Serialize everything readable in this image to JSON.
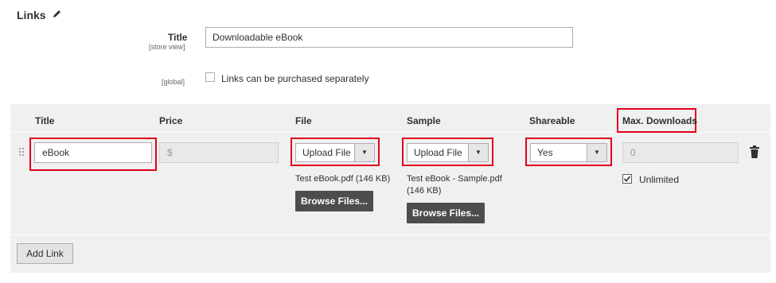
{
  "section": {
    "title": "Links"
  },
  "link_section": {
    "title_label": "Title",
    "title_scope": "[store view]",
    "title_value": "Downloadable eBook",
    "separately_scope": "[global]",
    "separately_label": "Links can be purchased separately",
    "separately_checked": false
  },
  "grid": {
    "columns": [
      "Title",
      "Price",
      "File",
      "Sample",
      "Shareable",
      "Max. Downloads"
    ],
    "row": {
      "title_value": "eBook",
      "price_placeholder": "$",
      "file_select": "Upload File",
      "file_name": "Test eBook.pdf (146 KB)",
      "file_browse": "Browse Files...",
      "sample_select": "Upload File",
      "sample_name_line1": "Test eBook - Sample.pdf",
      "sample_name_line2": "(146 KB)",
      "sample_browse": "Browse Files...",
      "shareable_value": "Yes",
      "max_downloads_value": "0",
      "unlimited_label": "Unlimited",
      "unlimited_checked": true
    },
    "add_link_label": "Add Link"
  },
  "colors": {
    "highlight": "#e3001b",
    "dark_button": "#4d4d4d",
    "grid_bg": "#f0f0f0"
  },
  "icons": [
    "pencil-icon",
    "drag-handle-icon",
    "trash-icon",
    "chevron-down-icon",
    "checkmark-icon"
  ]
}
